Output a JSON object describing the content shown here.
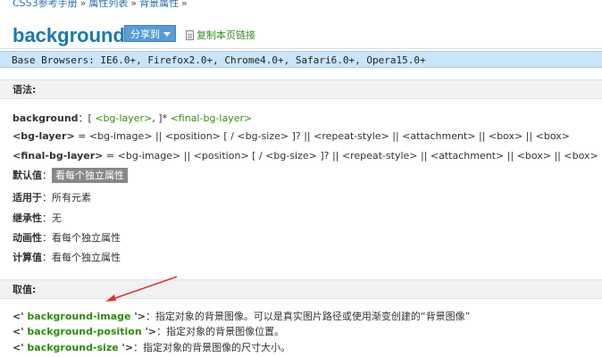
{
  "breadcrumb": {
    "home": "CSS3参考手册",
    "sep": "»",
    "list": "属性列表",
    "current": "背景属性",
    "trail": "»"
  },
  "page_title": "background",
  "share_button": "分享到",
  "copy_link": "复制本页链接",
  "browsers": "Base Browsers: IE6.0+, Firefox2.0+, Chrome4.0+, Safari6.0+, Opera15.0+",
  "syntax": {
    "heading": "语法:",
    "line1": {
      "name": "background",
      "rest_a": "：[ ",
      "bg_layer": "<bg-layer>",
      "rest_b": ", ]* ",
      "final": "<final-bg-layer>"
    },
    "line2": {
      "name": "<bg-layer>",
      "rest": " = <bg-image> || <position> [ / <bg-size> ]? || <repeat-style> || <attachment> || <box> || <box>"
    },
    "line3": {
      "name": "<final-bg-layer>",
      "rest": " = <bg-image> || <position> [ / <bg-size> ]? || <repeat-style> || <attachment> || <box> || <box> || <"
    },
    "default_label": "默认值",
    "default_value": "看每个独立属性",
    "applies_label": "适用于",
    "applies_value": "所有元素",
    "inherit_label": "继承性",
    "inherit_value": "无",
    "anim_label": "动画性",
    "anim_value": "看每个独立属性",
    "computed_label": "计算值",
    "computed_value": "看每个独立属性",
    "colon": "："
  },
  "values": {
    "heading": "取值:",
    "items": [
      {
        "open": "<' ",
        "name": "background-image",
        "close": " '>",
        "desc": "：指定对象的背景图像。可以是真实图片路径或使用渐变创建的“背景图像”"
      },
      {
        "open": "<' ",
        "name": "background-position",
        "close": " '>",
        "desc": "：指定对象的背景图像位置。"
      },
      {
        "open": "<' ",
        "name": "background-size",
        "close": " '>",
        "desc": "：指定对象的背景图像的尺寸大小。"
      }
    ]
  },
  "colors": {
    "accent": "#1a78b4",
    "green": "#2f8a0f",
    "browsers_bg": "#c9e5fb",
    "arrow": "#d9362b"
  }
}
